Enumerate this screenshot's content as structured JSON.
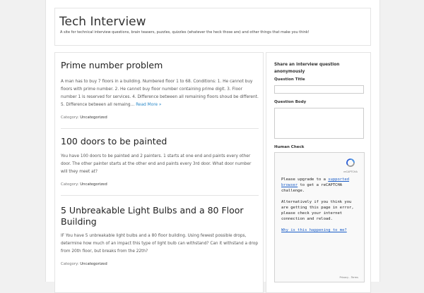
{
  "header": {
    "site_title": "Tech Interview",
    "site_description": "A site for technical interview questions, brain teasers, puzzles, quizzles (whatever the heck those are) and other things that make you think!"
  },
  "posts": [
    {
      "title": "Prime number problem",
      "excerpt": "A man has to buy 7 floors in a building. Numbered floor 1 to 68. Conditions: 1. He cannot buy floors with prime number. 2. He cannot buy floor number containing prime digit. 3. Floor number 1 is reserved for services. 4. Difference between all remaining floors shoud be different. 5. Difference between all remaing…",
      "read_more": "Read More »",
      "category_label": "Category:",
      "category": "Uncategorized"
    },
    {
      "title": "100 doors to be painted",
      "excerpt": "You have 100 doors to be painted and 2 painters. 1 starts at one end and paints every other door. The other painter starts at the other end and paints every 3rd door. What door number will they meet at?",
      "category_label": "Category:",
      "category": "Uncategorized"
    },
    {
      "title": "5 Unbreakable Light Bulbs and a 80 Floor Building",
      "excerpt": "IF You have 5 unbreakable light bulbs and a 80 floor building. Using fewest possible drops, determine how much of an impact this type of light bulb can withstand? Can it withstand a drop from 20th floor, but breaks from the 22th?",
      "category_label": "Category:",
      "category": "Uncategorized"
    }
  ],
  "sidebar": {
    "widget_title": "Share an interview question anonymously",
    "question_title_label": "Question Title",
    "question_title_value": "",
    "question_body_label": "Question Body",
    "question_body_value": "",
    "human_check_label": "Human Check",
    "captcha": {
      "logo_text": "reCAPTCHA",
      "msg_line1_pre": "Please upgrade to a ",
      "msg_link1": "supported browser",
      "msg_line1_post": " to get a reCAPTCHA challenge.",
      "msg_line2": "Alternatively if you think you are getting this page in error, please check your internet connection and reload.",
      "msg_link2": "Why is this happening to me?",
      "footer": "Privacy - Terms"
    }
  },
  "colors": {
    "link": "#2a88c8",
    "border": "#e4e4e4",
    "background": "#f1f1f1"
  }
}
